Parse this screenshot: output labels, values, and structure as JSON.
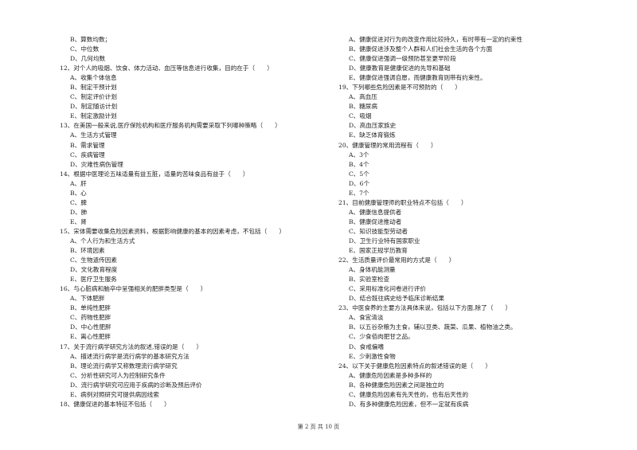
{
  "left_column": [
    {
      "type": "opt",
      "text": "B、算数均数；"
    },
    {
      "type": "opt",
      "text": "C、中位数"
    },
    {
      "type": "opt",
      "text": "D、几何均数"
    },
    {
      "type": "q",
      "text": "12、对个人的吸烟、饮食、体力活动、血压等信息进行收集，目的在于（　　）"
    },
    {
      "type": "opt",
      "text": "A、收集个体信息"
    },
    {
      "type": "opt",
      "text": "B、制定干预计划"
    },
    {
      "type": "opt",
      "text": "C、制定评价计划"
    },
    {
      "type": "opt",
      "text": "D、制定随访计划"
    },
    {
      "type": "opt",
      "text": "E、制定激励计划"
    },
    {
      "type": "q",
      "text": "13、在美国一般来说,医疗保险机构和医疗服务机构需要采取下列哪种策略（　　）"
    },
    {
      "type": "opt",
      "text": "A、生活方式管理"
    },
    {
      "type": "opt",
      "text": "B、需求管理"
    },
    {
      "type": "opt",
      "text": "C、疾病管理"
    },
    {
      "type": "opt",
      "text": "D、灾难性病伤管理"
    },
    {
      "type": "q",
      "text": "14、根据中医理论五味适量有益五脏，适量的苦味食品有益于（　　）"
    },
    {
      "type": "opt",
      "text": "A、肝"
    },
    {
      "type": "opt",
      "text": "B、心"
    },
    {
      "type": "opt",
      "text": "C、脾"
    },
    {
      "type": "opt",
      "text": "D、肺"
    },
    {
      "type": "opt",
      "text": "E、肾"
    },
    {
      "type": "q",
      "text": "15、宋体需要收集危险因素资料，根据影响健康的基本的因素考虑，不包括（　　）"
    },
    {
      "type": "opt",
      "text": "A、个人行为和生活方式"
    },
    {
      "type": "opt",
      "text": "B、环境因素"
    },
    {
      "type": "opt",
      "text": "C、生物遗传因素"
    },
    {
      "type": "opt",
      "text": "D、文化教育程度"
    },
    {
      "type": "opt",
      "text": "E、医疗卫生服务"
    },
    {
      "type": "q",
      "text": "16、与心脏病和脑卒中呈强相关的肥胖类型是（　　）"
    },
    {
      "type": "opt",
      "text": "A、下体肥胖"
    },
    {
      "type": "opt",
      "text": "B、单纯性肥胖"
    },
    {
      "type": "opt",
      "text": "C、药物性肥胖"
    },
    {
      "type": "opt",
      "text": "D、中心性肥胖"
    },
    {
      "type": "opt",
      "text": "E、离心性肥胖"
    },
    {
      "type": "q",
      "text": "17、关于流行病学研究方法的叙述,错误的是（　　）"
    },
    {
      "type": "opt",
      "text": "A、描述流行病学是流行病学的基本研究方法"
    },
    {
      "type": "opt",
      "text": "B、理论流行病学又称数理流行病学研究"
    },
    {
      "type": "opt",
      "text": "C、分析性研究可人为控制研究条件"
    },
    {
      "type": "opt",
      "text": "D、流行病学研究可应用于疾病的诊断及预后评价"
    },
    {
      "type": "opt",
      "text": "E、病例对照研究可提供病因线索"
    },
    {
      "type": "q",
      "text": "18、健康促进的基本特征不包括（　　）"
    }
  ],
  "right_column": [
    {
      "type": "opt",
      "text": "A、健康促进对行为的改变作用比较持久，有时带有一定的约束性"
    },
    {
      "type": "opt",
      "text": "B、健康促进涉及整个人群和人们社会生活的各个方面"
    },
    {
      "type": "opt",
      "text": "C、健康促进强调一级预防甚至更早阶段"
    },
    {
      "type": "opt",
      "text": "D、健康教育是健康促进的先导和基础"
    },
    {
      "type": "opt",
      "text": "E、健康促进强调自愿，而健康教育则带有约束性。"
    },
    {
      "type": "q",
      "text": "19、下列哪些危险因素是不可预防的（　　）"
    },
    {
      "type": "opt",
      "text": "A、高血压"
    },
    {
      "type": "opt",
      "text": "B、糖尿病"
    },
    {
      "type": "opt",
      "text": "C、吸烟"
    },
    {
      "type": "opt",
      "text": "D、高血压家族史"
    },
    {
      "type": "opt",
      "text": "E、缺乏体育锻炼"
    },
    {
      "type": "q",
      "text": "20、健康管理的常用流程有（　　）"
    },
    {
      "type": "opt",
      "text": "A、3个"
    },
    {
      "type": "opt",
      "text": "B、4个"
    },
    {
      "type": "opt",
      "text": "C、5个"
    },
    {
      "type": "opt",
      "text": "D、6个"
    },
    {
      "type": "opt",
      "text": "E、7个"
    },
    {
      "type": "q",
      "text": "21、目前健康管理师的职业特点不包括（　　）"
    },
    {
      "type": "opt",
      "text": "A、健康信息提供者"
    },
    {
      "type": "opt",
      "text": "B、健康促进推动者"
    },
    {
      "type": "opt",
      "text": "C、知识技能型劳动者"
    },
    {
      "type": "opt",
      "text": "D、卫生行业特有国家职业"
    },
    {
      "type": "opt",
      "text": "E、国家正规学历教育"
    },
    {
      "type": "q",
      "text": "22、生活质量评价最常用的方式是（　　）"
    },
    {
      "type": "opt",
      "text": "A、身体机能测量"
    },
    {
      "type": "opt",
      "text": "B、实验室检查"
    },
    {
      "type": "opt",
      "text": "C、采用标准化问卷进行评价"
    },
    {
      "type": "opt",
      "text": "D、结合既往病史给予临床诊断结果"
    },
    {
      "type": "q",
      "text": "23、中医食养的主要方法具体来说，包括以下方面,除了（　　）"
    },
    {
      "type": "opt",
      "text": "A、食宜清淡"
    },
    {
      "type": "opt",
      "text": "B、以五谷杂粮为主食，辅以豆类、蔬菜、瓜果、植物油之类。"
    },
    {
      "type": "opt",
      "text": "C、少食佰肉肥甘之品。"
    },
    {
      "type": "opt",
      "text": "D、食戒偏嗜"
    },
    {
      "type": "opt",
      "text": "E、少刺激性食物"
    },
    {
      "type": "q",
      "text": "24、以下关于健康危险因素特点的叙述错误的是（　　）"
    },
    {
      "type": "opt",
      "text": "A、健康危险因素是多种多样的"
    },
    {
      "type": "opt",
      "text": "B、各种健康危险因素之间是独立的"
    },
    {
      "type": "opt",
      "text": "C、健康危险因素有先天性的，也有后天性的"
    },
    {
      "type": "opt",
      "text": "D、有多种健康危险因素，但不一定就有疾病"
    }
  ],
  "footer": {
    "page_label": "第 2 页 共 10 页"
  }
}
